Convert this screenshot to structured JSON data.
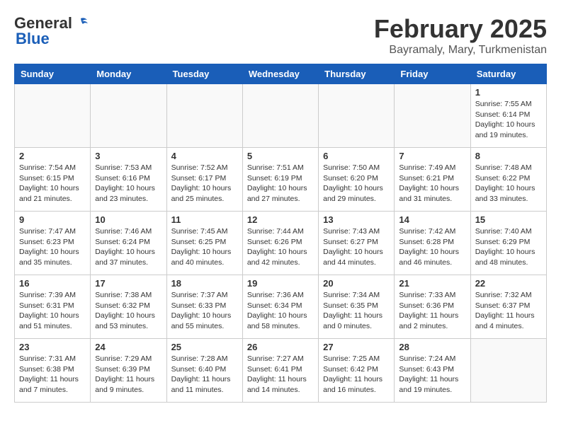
{
  "header": {
    "logo_general": "General",
    "logo_blue": "Blue",
    "month_year": "February 2025",
    "location": "Bayramaly, Mary, Turkmenistan"
  },
  "weekdays": [
    "Sunday",
    "Monday",
    "Tuesday",
    "Wednesday",
    "Thursday",
    "Friday",
    "Saturday"
  ],
  "weeks": [
    [
      {
        "day": "",
        "info": ""
      },
      {
        "day": "",
        "info": ""
      },
      {
        "day": "",
        "info": ""
      },
      {
        "day": "",
        "info": ""
      },
      {
        "day": "",
        "info": ""
      },
      {
        "day": "",
        "info": ""
      },
      {
        "day": "1",
        "info": "Sunrise: 7:55 AM\nSunset: 6:14 PM\nDaylight: 10 hours\nand 19 minutes."
      }
    ],
    [
      {
        "day": "2",
        "info": "Sunrise: 7:54 AM\nSunset: 6:15 PM\nDaylight: 10 hours\nand 21 minutes."
      },
      {
        "day": "3",
        "info": "Sunrise: 7:53 AM\nSunset: 6:16 PM\nDaylight: 10 hours\nand 23 minutes."
      },
      {
        "day": "4",
        "info": "Sunrise: 7:52 AM\nSunset: 6:17 PM\nDaylight: 10 hours\nand 25 minutes."
      },
      {
        "day": "5",
        "info": "Sunrise: 7:51 AM\nSunset: 6:19 PM\nDaylight: 10 hours\nand 27 minutes."
      },
      {
        "day": "6",
        "info": "Sunrise: 7:50 AM\nSunset: 6:20 PM\nDaylight: 10 hours\nand 29 minutes."
      },
      {
        "day": "7",
        "info": "Sunrise: 7:49 AM\nSunset: 6:21 PM\nDaylight: 10 hours\nand 31 minutes."
      },
      {
        "day": "8",
        "info": "Sunrise: 7:48 AM\nSunset: 6:22 PM\nDaylight: 10 hours\nand 33 minutes."
      }
    ],
    [
      {
        "day": "9",
        "info": "Sunrise: 7:47 AM\nSunset: 6:23 PM\nDaylight: 10 hours\nand 35 minutes."
      },
      {
        "day": "10",
        "info": "Sunrise: 7:46 AM\nSunset: 6:24 PM\nDaylight: 10 hours\nand 37 minutes."
      },
      {
        "day": "11",
        "info": "Sunrise: 7:45 AM\nSunset: 6:25 PM\nDaylight: 10 hours\nand 40 minutes."
      },
      {
        "day": "12",
        "info": "Sunrise: 7:44 AM\nSunset: 6:26 PM\nDaylight: 10 hours\nand 42 minutes."
      },
      {
        "day": "13",
        "info": "Sunrise: 7:43 AM\nSunset: 6:27 PM\nDaylight: 10 hours\nand 44 minutes."
      },
      {
        "day": "14",
        "info": "Sunrise: 7:42 AM\nSunset: 6:28 PM\nDaylight: 10 hours\nand 46 minutes."
      },
      {
        "day": "15",
        "info": "Sunrise: 7:40 AM\nSunset: 6:29 PM\nDaylight: 10 hours\nand 48 minutes."
      }
    ],
    [
      {
        "day": "16",
        "info": "Sunrise: 7:39 AM\nSunset: 6:31 PM\nDaylight: 10 hours\nand 51 minutes."
      },
      {
        "day": "17",
        "info": "Sunrise: 7:38 AM\nSunset: 6:32 PM\nDaylight: 10 hours\nand 53 minutes."
      },
      {
        "day": "18",
        "info": "Sunrise: 7:37 AM\nSunset: 6:33 PM\nDaylight: 10 hours\nand 55 minutes."
      },
      {
        "day": "19",
        "info": "Sunrise: 7:36 AM\nSunset: 6:34 PM\nDaylight: 10 hours\nand 58 minutes."
      },
      {
        "day": "20",
        "info": "Sunrise: 7:34 AM\nSunset: 6:35 PM\nDaylight: 11 hours\nand 0 minutes."
      },
      {
        "day": "21",
        "info": "Sunrise: 7:33 AM\nSunset: 6:36 PM\nDaylight: 11 hours\nand 2 minutes."
      },
      {
        "day": "22",
        "info": "Sunrise: 7:32 AM\nSunset: 6:37 PM\nDaylight: 11 hours\nand 4 minutes."
      }
    ],
    [
      {
        "day": "23",
        "info": "Sunrise: 7:31 AM\nSunset: 6:38 PM\nDaylight: 11 hours\nand 7 minutes."
      },
      {
        "day": "24",
        "info": "Sunrise: 7:29 AM\nSunset: 6:39 PM\nDaylight: 11 hours\nand 9 minutes."
      },
      {
        "day": "25",
        "info": "Sunrise: 7:28 AM\nSunset: 6:40 PM\nDaylight: 11 hours\nand 11 minutes."
      },
      {
        "day": "26",
        "info": "Sunrise: 7:27 AM\nSunset: 6:41 PM\nDaylight: 11 hours\nand 14 minutes."
      },
      {
        "day": "27",
        "info": "Sunrise: 7:25 AM\nSunset: 6:42 PM\nDaylight: 11 hours\nand 16 minutes."
      },
      {
        "day": "28",
        "info": "Sunrise: 7:24 AM\nSunset: 6:43 PM\nDaylight: 11 hours\nand 19 minutes."
      },
      {
        "day": "",
        "info": ""
      }
    ]
  ]
}
